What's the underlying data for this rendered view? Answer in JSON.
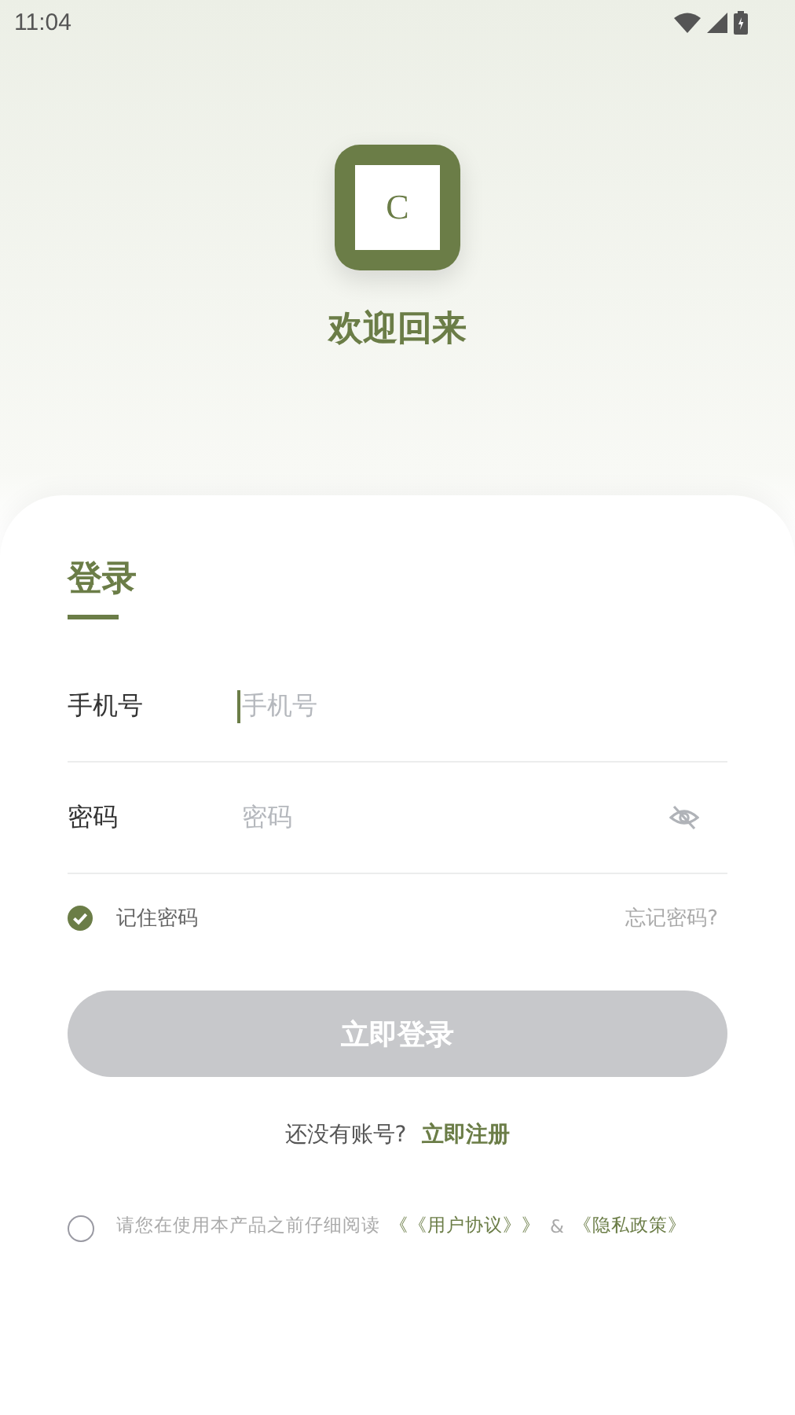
{
  "status_bar": {
    "time": "11:04"
  },
  "logo": {
    "letter": "C"
  },
  "welcome": "欢迎回来",
  "tabs": [
    {
      "label": "登录",
      "selected": true
    }
  ],
  "fields": [
    {
      "label": "手机号",
      "placeholder": "手机号",
      "focused": true,
      "kind": "text"
    },
    {
      "label": "密码",
      "placeholder": "密码",
      "focused": false,
      "kind": "password"
    }
  ],
  "remember": {
    "label": "记住密码",
    "checked": true
  },
  "forgot": "忘记密码?",
  "login_button": {
    "label": "立即登录",
    "disabled": true
  },
  "register": {
    "prompt": "还没有账号?",
    "link": "立即注册"
  },
  "agreement": {
    "checked": false,
    "text": "请您在使用本产品之前仔细阅读",
    "link_1": "《《用户协议》》",
    "joiner": "&",
    "link_2": "《隐私政策》"
  }
}
